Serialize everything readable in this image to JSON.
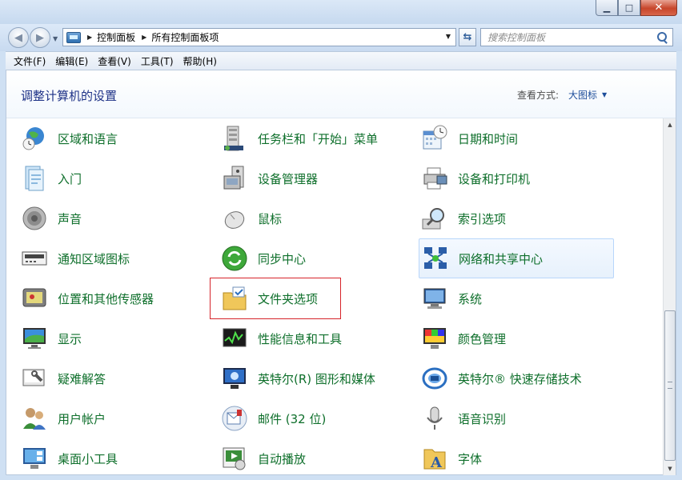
{
  "window": {
    "minimize_glyph": "▁",
    "maximize_glyph": "□",
    "close_glyph": "✕"
  },
  "nav": {
    "back_glyph": "◀",
    "forward_glyph": "▶",
    "breadcrumb": [
      "控制面板",
      "所有控制面板项"
    ],
    "search_placeholder": "搜索控制面板"
  },
  "menu": [
    "文件(F)",
    "编辑(E)",
    "查看(V)",
    "工具(T)",
    "帮助(H)"
  ],
  "header": {
    "title": "调整计算机的设置",
    "view_label": "查看方式:",
    "view_value": "大图标"
  },
  "items": [
    {
      "label": "区域和语言",
      "icon": "globe-clock-icon",
      "name": "region-language"
    },
    {
      "label": "任务栏和「开始」菜单",
      "icon": "taskbar-icon",
      "name": "taskbar-start-menu"
    },
    {
      "label": "日期和时间",
      "icon": "calendar-clock-icon",
      "name": "date-time"
    },
    {
      "label": "入门",
      "icon": "getting-started-icon",
      "name": "getting-started"
    },
    {
      "label": "设备管理器",
      "icon": "device-manager-icon",
      "name": "device-manager"
    },
    {
      "label": "设备和打印机",
      "icon": "printer-icon",
      "name": "devices-printers"
    },
    {
      "label": "声音",
      "icon": "speaker-icon",
      "name": "sound"
    },
    {
      "label": "鼠标",
      "icon": "mouse-icon",
      "name": "mouse"
    },
    {
      "label": "索引选项",
      "icon": "magnifier-icon",
      "name": "indexing-options"
    },
    {
      "label": "通知区域图标",
      "icon": "notification-area-icon",
      "name": "notification-area-icons"
    },
    {
      "label": "同步中心",
      "icon": "sync-center-icon",
      "name": "sync-center"
    },
    {
      "label": "网络和共享中心",
      "icon": "network-icon",
      "name": "network-sharing-center"
    },
    {
      "label": "位置和其他传感器",
      "icon": "location-sensor-icon",
      "name": "location-sensors"
    },
    {
      "label": "文件夹选项",
      "icon": "folder-options-icon",
      "name": "folder-options"
    },
    {
      "label": "系统",
      "icon": "system-icon",
      "name": "system"
    },
    {
      "label": "显示",
      "icon": "display-icon",
      "name": "display"
    },
    {
      "label": "性能信息和工具",
      "icon": "performance-icon",
      "name": "performance-tools"
    },
    {
      "label": "颜色管理",
      "icon": "color-management-icon",
      "name": "color-management"
    },
    {
      "label": "疑难解答",
      "icon": "troubleshooting-icon",
      "name": "troubleshooting"
    },
    {
      "label": "英特尔(R) 图形和媒体",
      "icon": "intel-graphics-icon",
      "name": "intel-graphics-media"
    },
    {
      "label": "英特尔® 快速存储技术",
      "icon": "intel-rapid-storage-icon",
      "name": "intel-rapid-storage"
    },
    {
      "label": "用户帐户",
      "icon": "user-accounts-icon",
      "name": "user-accounts"
    },
    {
      "label": "邮件 (32 位)",
      "icon": "mail-icon",
      "name": "mail-32bit"
    },
    {
      "label": "语音识别",
      "icon": "microphone-icon",
      "name": "speech-recognition"
    },
    {
      "label": "桌面小工具",
      "icon": "gadgets-icon",
      "name": "desktop-gadgets"
    },
    {
      "label": "自动播放",
      "icon": "autoplay-icon",
      "name": "autoplay"
    },
    {
      "label": "字体",
      "icon": "fonts-icon",
      "name": "fonts"
    }
  ],
  "highlight": {
    "hovered": "网络和共享中心",
    "boxed": "文件夹选项"
  },
  "colors": {
    "link_green": "#0e6f2b",
    "title_blue": "#1e3287",
    "box_red": "#d6232a"
  }
}
